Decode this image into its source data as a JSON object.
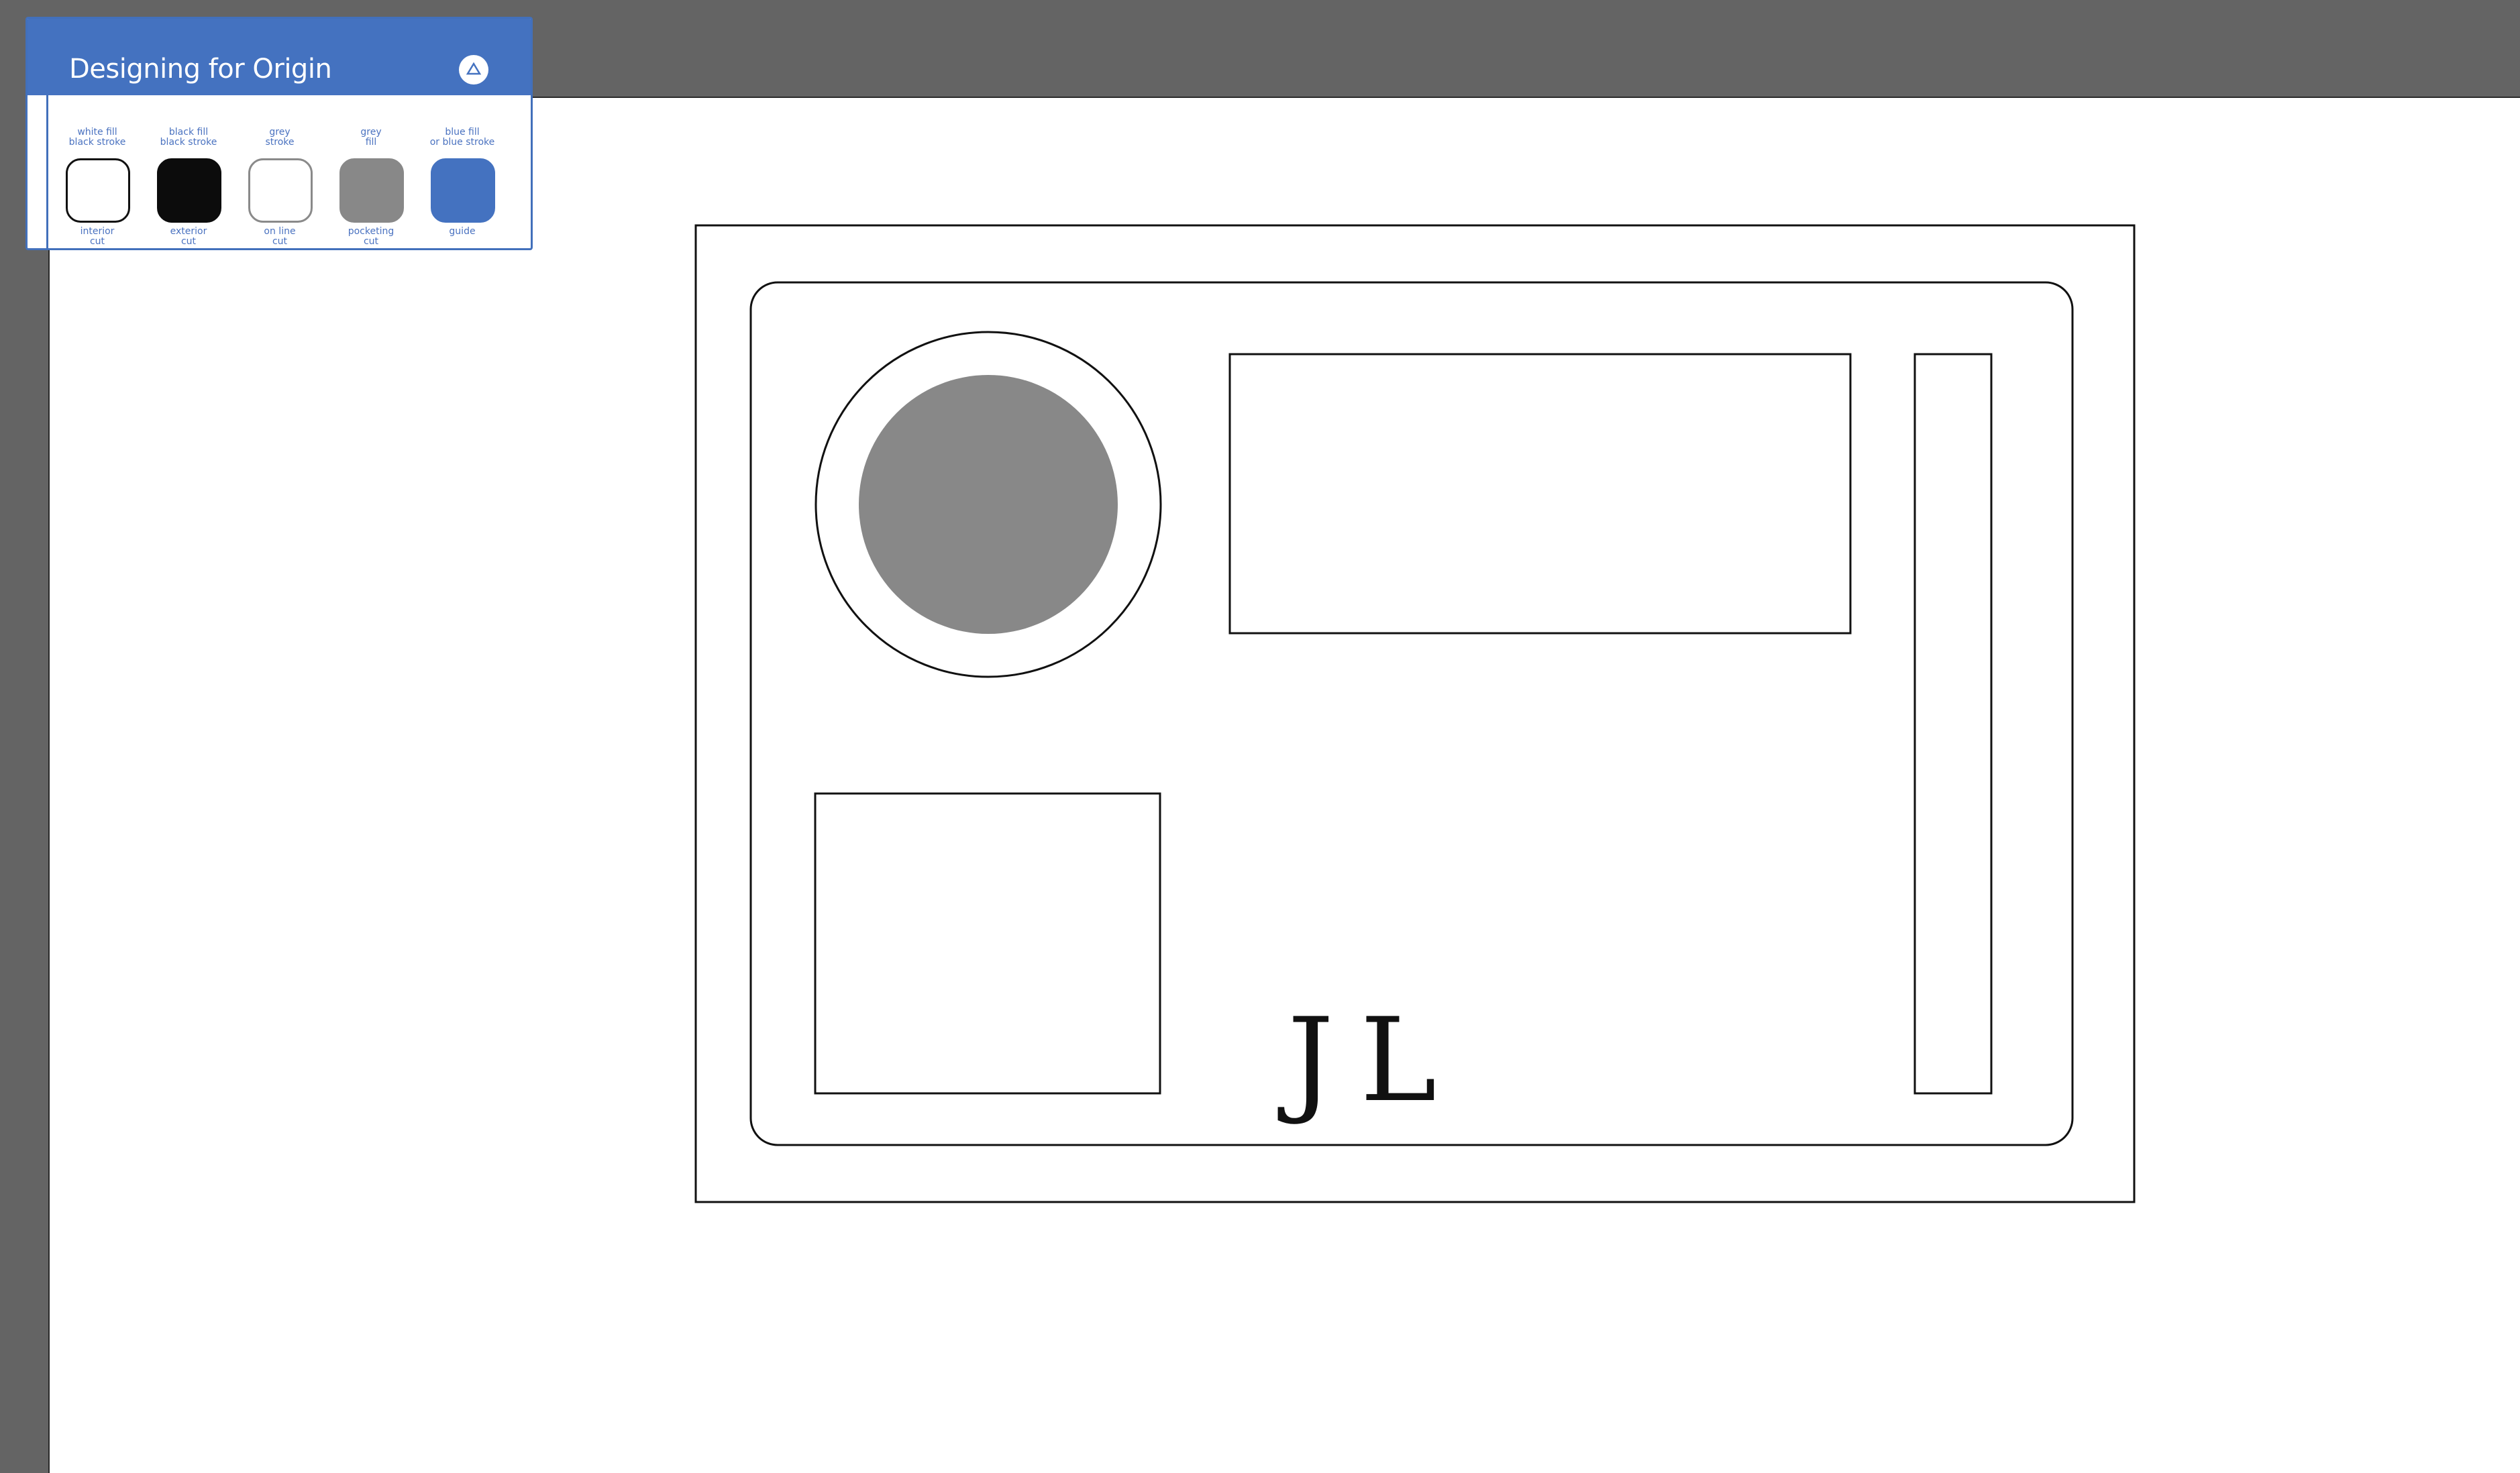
{
  "panel": {
    "title": "Designing for Origin",
    "collapse_icon": "triangle-up-icon",
    "swatches": [
      {
        "id": "interior",
        "top_line1": "white fill",
        "top_line2": "black stroke",
        "bottom_line1": "interior",
        "bottom_line2": "cut",
        "fill": "#ffffff",
        "stroke": "#111111"
      },
      {
        "id": "exterior",
        "top_line1": "black fill",
        "top_line2": "black stroke",
        "bottom_line1": "exterior",
        "bottom_line2": "cut",
        "fill": "#0c0c0c",
        "stroke": "#0c0c0c"
      },
      {
        "id": "online",
        "top_line1": "grey",
        "top_line2": "stroke",
        "bottom_line1": "on line",
        "bottom_line2": "cut",
        "fill": "#ffffff",
        "stroke": "#8a8a8a"
      },
      {
        "id": "pocketing",
        "top_line1": "grey",
        "top_line2": "fill",
        "bottom_line1": "pocketing",
        "bottom_line2": "cut",
        "fill": "#888888",
        "stroke": "#888888"
      },
      {
        "id": "guide",
        "top_line1": "blue fill",
        "top_line2": "or blue stroke",
        "bottom_line1": "guide",
        "bottom_line2": "",
        "fill": "#4472c0",
        "stroke": "#4472c0"
      }
    ]
  },
  "canvas": {
    "initials_j": "J",
    "initials_l": "L",
    "colors": {
      "workspace": "#646464",
      "artboard": "#ffffff",
      "stroke": "#111111",
      "pocket_fill": "#888888",
      "accent_blue": "#4472c0"
    }
  }
}
